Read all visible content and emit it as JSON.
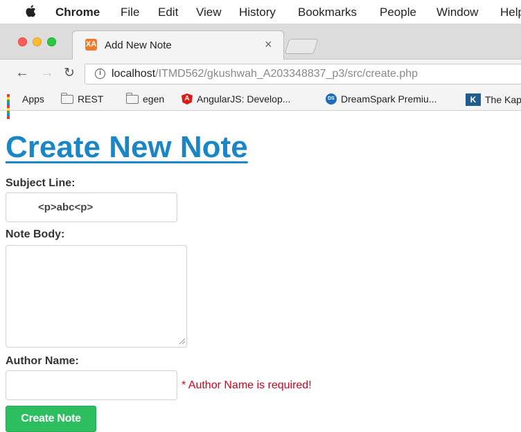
{
  "menubar": {
    "app": "Chrome",
    "items": [
      "File",
      "Edit",
      "View",
      "History",
      "Bookmarks",
      "People",
      "Window",
      "Help"
    ]
  },
  "tab": {
    "title": "Add New Note",
    "close": "×",
    "favicon_text": "XA"
  },
  "address": {
    "host": "localhost",
    "path": "/ITMD562/gkushwah_A203348837_p3/src/create.php"
  },
  "bookmarks": [
    {
      "label": "Apps",
      "icon": "apps-grid-icon"
    },
    {
      "label": "REST",
      "icon": "folder-icon"
    },
    {
      "label": "egen",
      "icon": "folder-icon"
    },
    {
      "label": "AngularJS: Develop...",
      "icon": "angular-icon"
    },
    {
      "label": "DreamSpark Premiu...",
      "icon": "dreamspark-icon"
    },
    {
      "label": "The Kap",
      "icon": "kaplan-icon"
    }
  ],
  "page": {
    "title": "Create New Note",
    "subject_label": "Subject Line:",
    "subject_value": "<p>abc<p>",
    "body_label": "Note Body:",
    "body_value": "",
    "author_label": "Author Name:",
    "author_value": "",
    "author_error": "* Author Name is required!",
    "submit_label": "Create Note"
  },
  "colors": {
    "link": "#1b86c6",
    "error": "#d0021b",
    "button": "#2dbe60"
  }
}
